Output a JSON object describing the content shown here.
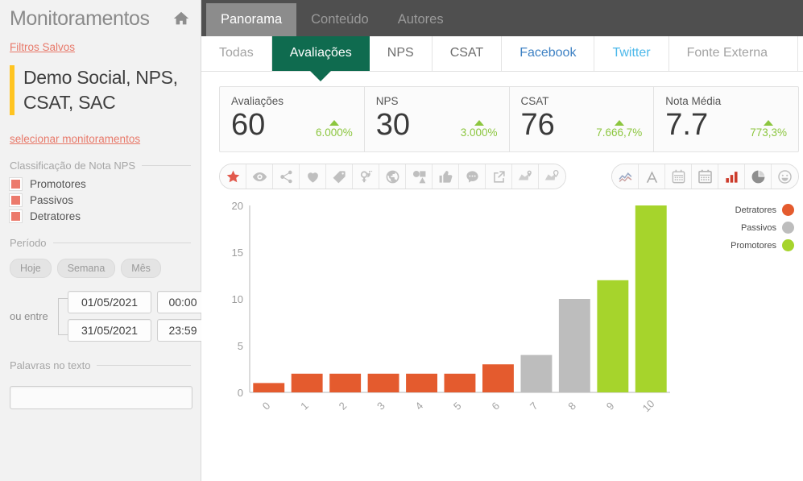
{
  "sidebar": {
    "title": "Monitoramentos",
    "home_icon": "home-icon",
    "saved_filters_link": "Filtros Salvos",
    "monitor_name": "Demo Social, NPS, CSAT, SAC",
    "select_monitors_link": "selecionar monitoramentos",
    "nps_section_title": "Classificação de Nota NPS",
    "nps_options": [
      {
        "label": "Promotores"
      },
      {
        "label": "Passivos"
      },
      {
        "label": "Detratores"
      }
    ],
    "period_section_title": "Período",
    "period_pills": [
      "Hoje",
      "Semana",
      "Mês"
    ],
    "between_label": "ou entre",
    "date_from": "01/05/2021",
    "time_from": "00:00",
    "date_to": "31/05/2021",
    "time_to": "23:59",
    "words_section_title": "Palavras no texto",
    "words_value": "",
    "words_placeholder": ""
  },
  "topbar": {
    "tabs": [
      {
        "label": "Panorama",
        "active": true
      },
      {
        "label": "Conteúdo",
        "active": false
      },
      {
        "label": "Autores",
        "active": false
      }
    ]
  },
  "subtabs": [
    {
      "label": "Todas",
      "style": "muted"
    },
    {
      "label": "Avaliações",
      "style": "active"
    },
    {
      "label": "NPS",
      "style": "dark"
    },
    {
      "label": "CSAT",
      "style": "dark"
    },
    {
      "label": "Facebook",
      "style": "blue"
    },
    {
      "label": "Twitter",
      "style": "lightblue"
    },
    {
      "label": "Fonte Externa",
      "style": "muted"
    }
  ],
  "kpis": [
    {
      "label": "Avaliações",
      "value": "60",
      "delta": "6.000%"
    },
    {
      "label": "NPS",
      "value": "30",
      "delta": "3.000%"
    },
    {
      "label": "CSAT",
      "value": "76",
      "delta": "7.666,7%"
    },
    {
      "label": "Nota Média",
      "value": "7.7",
      "delta": "773,3%"
    }
  ],
  "left_toolbar": [
    {
      "icon": "star-icon",
      "active": true
    },
    {
      "icon": "eye-icon",
      "active": false
    },
    {
      "icon": "share-icon",
      "active": false
    },
    {
      "icon": "heart-icon",
      "active": false
    },
    {
      "icon": "tag-icon",
      "active": false
    },
    {
      "icon": "gender-icon",
      "active": false
    },
    {
      "icon": "globe-icon",
      "active": false
    },
    {
      "icon": "shapes-icon",
      "active": false
    },
    {
      "icon": "thumbs-up-icon",
      "active": false
    },
    {
      "icon": "comment-icon",
      "active": false
    },
    {
      "icon": "export-icon",
      "active": false
    },
    {
      "icon": "map-pin-icon",
      "active": false
    },
    {
      "icon": "map-pin-alt-icon",
      "active": false
    }
  ],
  "right_toolbar": [
    {
      "icon": "line-chart-icon",
      "active": false
    },
    {
      "icon": "text-icon",
      "active": false
    },
    {
      "icon": "calendar-icon",
      "active": false
    },
    {
      "icon": "calendar-alt-icon",
      "active": false
    },
    {
      "icon": "bar-chart-icon",
      "active": true
    },
    {
      "icon": "pie-chart-icon",
      "active": false
    },
    {
      "icon": "smiley-icon",
      "active": false
    }
  ],
  "colors": {
    "detratores": "#e45b2e",
    "passivos": "#bdbdbd",
    "promotores": "#a6d42c",
    "accent_green": "#0f6b4f",
    "link_red": "#e8796a",
    "kpi_green": "#8cc63f",
    "monitor_bar": "#ffc421"
  },
  "chart_data": {
    "type": "bar",
    "title": "",
    "xlabel": "",
    "ylabel": "",
    "categories": [
      "0",
      "1",
      "2",
      "3",
      "4",
      "5",
      "6",
      "7",
      "8",
      "9",
      "10"
    ],
    "values": [
      1,
      2,
      2,
      2,
      2,
      2,
      3,
      4,
      10,
      12,
      20
    ],
    "bar_colors": [
      "#e45b2e",
      "#e45b2e",
      "#e45b2e",
      "#e45b2e",
      "#e45b2e",
      "#e45b2e",
      "#e45b2e",
      "#bdbdbd",
      "#bdbdbd",
      "#a6d42c",
      "#a6d42c"
    ],
    "ylim": [
      0,
      20
    ],
    "yticks": [
      0,
      5,
      10,
      15,
      20
    ],
    "grid": false,
    "legend_position": "right-top",
    "legend": [
      {
        "name": "Detratores",
        "color": "#e45b2e"
      },
      {
        "name": "Passivos",
        "color": "#bdbdbd"
      },
      {
        "name": "Promotores",
        "color": "#a6d42c"
      }
    ]
  }
}
